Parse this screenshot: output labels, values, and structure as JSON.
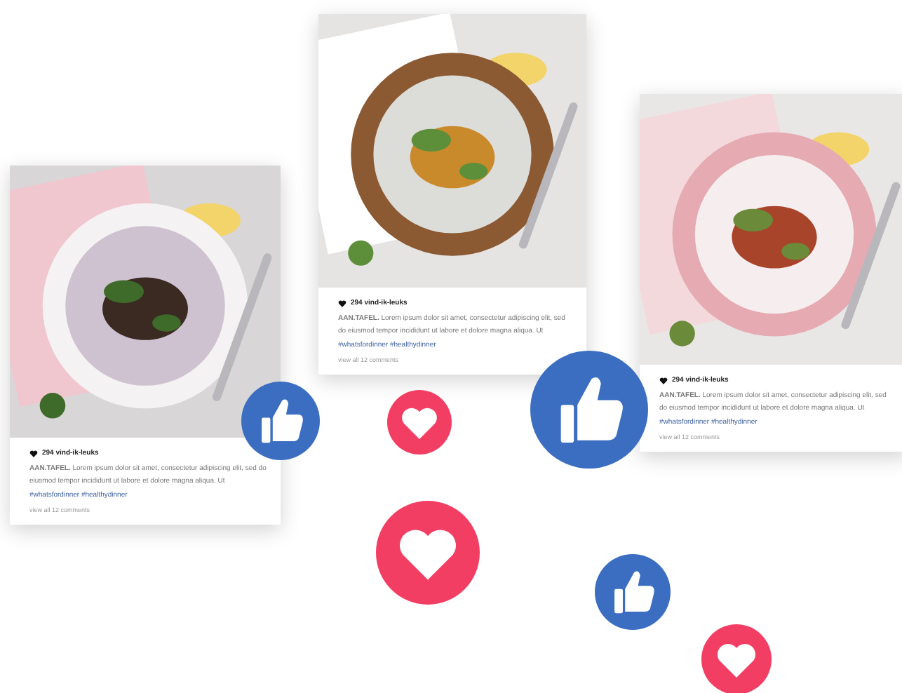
{
  "posts": [
    {
      "likes": "294 vind-ik-leuks",
      "caption": "**AAN.TAFEL.** Lorem ipsum dolor sit amet, consectetur adipiscing elit, sed do eiusmod tempor incididunt ut labore et dolore magna aliqua. Ut",
      "hashtags": "#whatsfordinner #healthydinner",
      "comments": "view all 12 comments"
    },
    {
      "likes": "294 vind-ik-leuks",
      "caption": "**AAN.TAFEL.** Lorem ipsum dolor sit amet, consectetur adipiscing elit, sed do eiusmod tempor incididunt ut labore et dolore magna aliqua. Ut",
      "hashtags": "#whatsfordinner #healthydinner",
      "comments": "view all 12 comments"
    },
    {
      "likes": "294 vind-ik-leuks",
      "caption": "**AAN.TAFEL.** Lorem ipsum dolor sit amet, consectetur adipiscing elit, sed do eiusmod tempor incididunt ut labore et dolore magna aliqua. Ut",
      "hashtags": "#whatsfordinner #healthydinner",
      "comments": "view all 12 comments"
    }
  ],
  "reactions": [
    {
      "kind": "like"
    },
    {
      "kind": "love"
    },
    {
      "kind": "like"
    },
    {
      "kind": "love"
    },
    {
      "kind": "like"
    },
    {
      "kind": "love"
    }
  ]
}
